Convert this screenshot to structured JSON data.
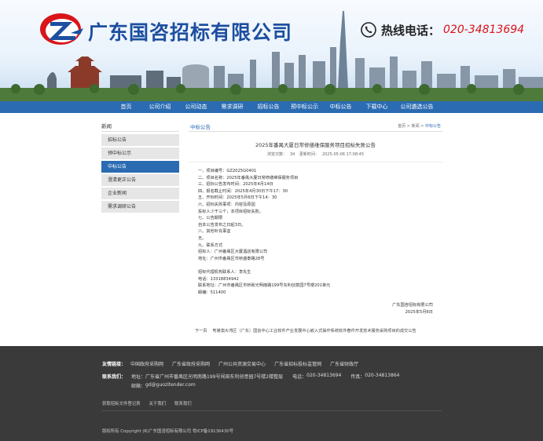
{
  "header": {
    "company_name": "广东国咨招标有限公司",
    "hotline_label": "热线电话：",
    "hotline_number": "020-34813694",
    "logo_colors": {
      "red": "#d9141a",
      "blue": "#1d4fa0"
    }
  },
  "nav": {
    "items": [
      "首页",
      "公司介绍",
      "公司动态",
      "需求调研",
      "招标公告",
      "预中标公示",
      "中标公告",
      "下载中心",
      "公司遴选公告"
    ]
  },
  "sidebar": {
    "title": "新闻",
    "items": [
      "招标公告",
      "预中标公示",
      "中标公告",
      "澄清更正公告",
      "企业新闻",
      "需求调研公告"
    ],
    "active_index": 2
  },
  "main": {
    "section_title": "中标公告",
    "breadcrumb": {
      "home": "首页",
      "sep1": " > ",
      "parent": "新闻",
      "sep2": " > ",
      "current": "中标公告"
    },
    "article": {
      "title": "2025年番禺大厦日常修缮维保服务项目招标失败公告",
      "views_label": "浏览次数：",
      "views": "34",
      "updated_label": "更新时间：",
      "updated": "2025-05-06 17:08:45",
      "lines": [
        "一、项目编号：GZ2025G0401",
        "二、项目名称：2025年番禺大厦日常修缮维保服务项目",
        "三、招标公告发布时间：2025年4月14日",
        "四、报名截止时间：2025年4月30日下午17：30",
        "五、开标时间：2025年5月6日下午14：30",
        "六、招标失败事项：内容及原因",
        "投标人少于三个，本项目招标失败。",
        "七、公告期限",
        "自本公告发布之日起3日。",
        "八、其他补充事宜",
        "无。",
        "九、联系方式",
        "招标人：广州番禺区大厦酒店有限公司",
        "地址：广州市番禺区市桥盛泰路28号",
        "",
        "招标代理机构联系人：李先生",
        "电话：13318834942",
        "联系地址：广州市番禺区市桥街光明南路199号东利创意园7号楼201单元",
        "邮编：511400"
      ],
      "signature_org": "广东国咨招标有限公司",
      "signature_date": "2025年5月6日"
    },
    "prev_next": {
      "label": "下一页",
      "link": "粤港澳大湾区（广东）国创中心工业软件产业发展中心嵌入式操作系统软件春件开发技术服务采购项目的成交公告"
    }
  },
  "footer": {
    "links_label": "友情链接：",
    "links": [
      "中国政府采购网",
      "广东省政府采购网",
      "广州公共资源交易中心",
      "广东省招标投标监管网",
      "广东省财政厅"
    ],
    "contact_label": "联系我们：",
    "address_label": "地址：",
    "address": "广东省广州市番禺区光明南路199号闯田东利创意园7号楼2楼整层",
    "phone_label": "电话：",
    "phone": "020-34813694",
    "fax_label": "传真：",
    "fax": "020-34813864",
    "email_label": "邮箱：",
    "email": "gd@guozitender.com",
    "bottom_links": [
      "获取招标文件登记表",
      "关于我们",
      "联系我们"
    ],
    "copyright": "版权所有 Copyright (R)广东国咨招标有限公司 粤ICP备19136430号"
  }
}
